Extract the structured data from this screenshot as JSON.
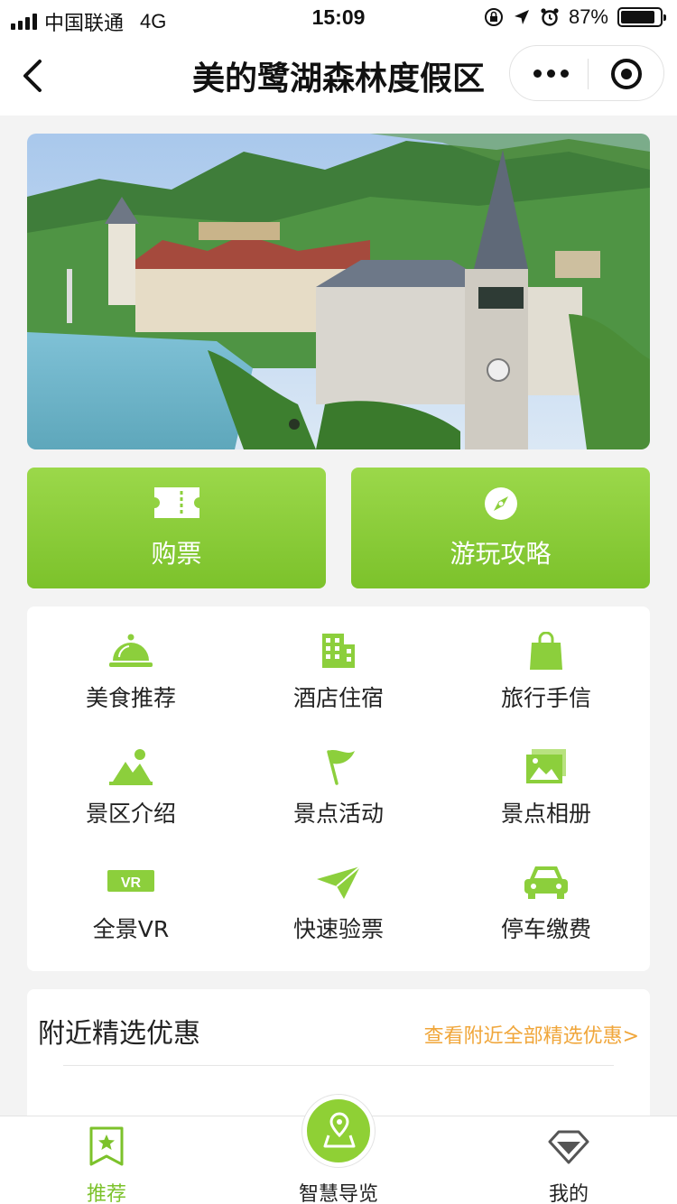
{
  "status_bar": {
    "carrier": "中国联通",
    "network": "4G",
    "time": "15:09",
    "battery": "87%",
    "battery_level": 0.87
  },
  "nav": {
    "title": "美的鹭湖森林度假区",
    "icons": [
      "back-icon",
      "more-icon",
      "target-icon"
    ]
  },
  "banner": {
    "page_count": 1,
    "active_index": 0
  },
  "actions": [
    {
      "label": "购票",
      "icon": "ticket-icon"
    },
    {
      "label": "游玩攻略",
      "icon": "compass-icon"
    }
  ],
  "grid": [
    {
      "label": "美食推荐",
      "icon": "food-cloche-icon"
    },
    {
      "label": "酒店住宿",
      "icon": "building-icon"
    },
    {
      "label": "旅行手信",
      "icon": "shopping-bag-icon"
    },
    {
      "label": "景区介绍",
      "icon": "landscape-icon"
    },
    {
      "label": "景点活动",
      "icon": "flag-icon"
    },
    {
      "label": "景点相册",
      "icon": "photo-album-icon"
    },
    {
      "label": "全景VR",
      "icon": "vr-icon"
    },
    {
      "label": "快速验票",
      "icon": "paper-plane-icon"
    },
    {
      "label": "停车缴费",
      "icon": "car-icon"
    }
  ],
  "deals": {
    "title": "附近精选优惠",
    "link": "查看附近全部精选优惠>"
  },
  "tabbar": [
    {
      "label": "推荐",
      "icon": "star-bookmark-icon",
      "active": true
    },
    {
      "label": "智慧导览",
      "icon": "map-pin-icon",
      "active": false
    },
    {
      "label": "我的",
      "icon": "diamond-icon",
      "active": false
    }
  ],
  "colors": {
    "accent_green": "#7cc22b",
    "link_orange": "#f0a63a"
  }
}
